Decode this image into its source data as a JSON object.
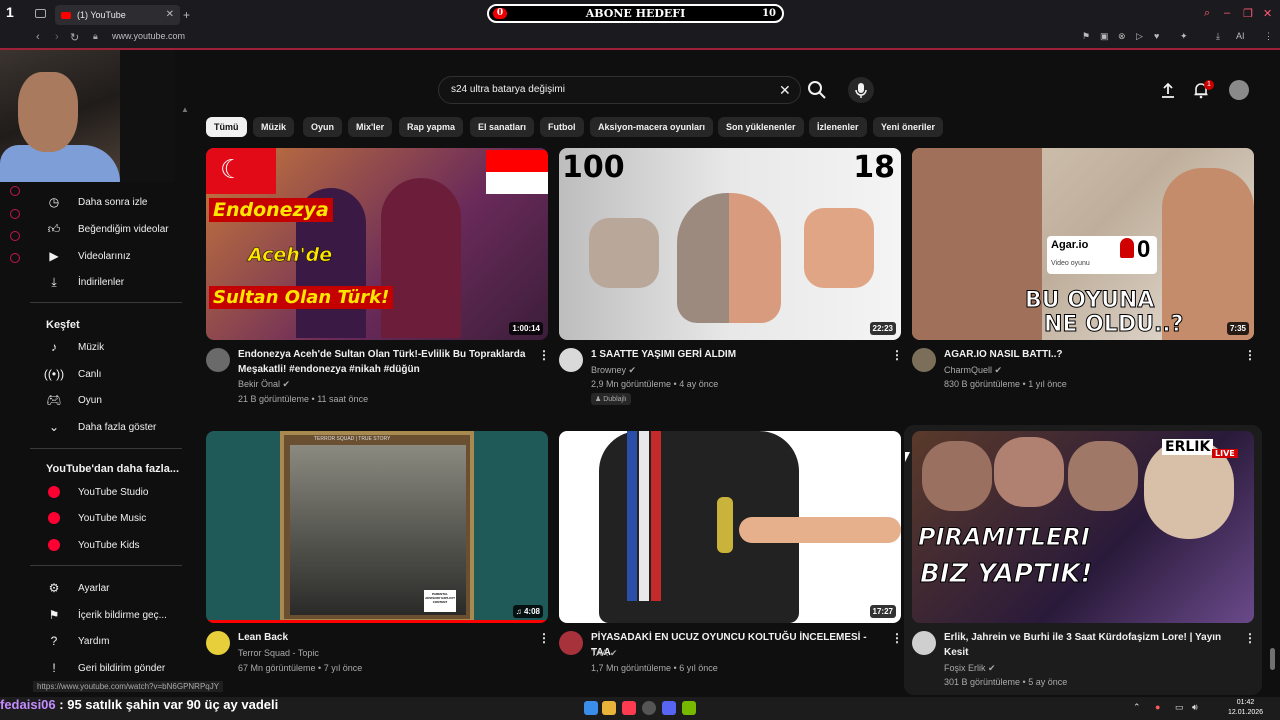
{
  "browser": {
    "tab_title": "(1) YouTube",
    "url": "www.youtube.com",
    "status_url": "https://www.youtube.com/watch?v=bN6GPNRPqJY"
  },
  "overlay": {
    "goal_label": "ABONE HEDEFI",
    "goal_current": "0",
    "goal_target": "10",
    "chat_user": "fedaisi06",
    "chat_message": " : 95 satılık şahin var 90 üç ay vadeli"
  },
  "search": {
    "query": "s24 ultra batarya değişimi"
  },
  "notifications": {
    "count": "1"
  },
  "sidebar": {
    "items_top": [
      {
        "label": "Daha sonra izle",
        "icon": "clock-icon"
      },
      {
        "label": "Beğendiğim videolar",
        "icon": "thumbs-up-icon"
      },
      {
        "label": "Videolarınız",
        "icon": "play-square-icon"
      },
      {
        "label": "İndirilenler",
        "icon": "download-icon"
      }
    ],
    "explore_heading": "Keşfet",
    "explore_items": [
      {
        "label": "Müzik",
        "icon": "music-icon"
      },
      {
        "label": "Canlı",
        "icon": "live-icon"
      },
      {
        "label": "Oyun",
        "icon": "gamepad-icon"
      },
      {
        "label": "Daha fazla göster",
        "icon": "chevron-down-icon"
      }
    ],
    "more_heading": "YouTube'dan daha fazla...",
    "more_items": [
      {
        "label": "YouTube Studio"
      },
      {
        "label": "YouTube Music"
      },
      {
        "label": "YouTube Kids"
      }
    ],
    "bottom_items": [
      {
        "label": "Ayarlar",
        "icon": "gear-icon"
      },
      {
        "label": "İçerik bildirme geç...",
        "icon": "flag-icon"
      },
      {
        "label": "Yardım",
        "icon": "help-icon"
      },
      {
        "label": "Geri bildirim gönder",
        "icon": "feedback-icon"
      }
    ]
  },
  "chips": [
    "Tümü",
    "Müzik",
    "Oyun",
    "Mix'ler",
    "Rap yapma",
    "El sanatları",
    "Futbol",
    "Aksiyon-macera oyunları",
    "Son yüklenenler",
    "İzlenenler",
    "Yeni öneriler"
  ],
  "videos": [
    {
      "title_1": "Endonezya Aceh'de Sultan Olan Türk!-Evlilik Bu Topraklarda",
      "title_2": "Meşakatli! #endonezya #nikah #düğün",
      "channel": "Bekir Önal",
      "meta": "21 B görüntüleme • 11 saat önce",
      "duration": "1:00:14",
      "thumb_text": [
        "Endonezya",
        "Aceh'de",
        "Sultan Olan Türk!"
      ]
    },
    {
      "title_1": "1 SAATTE YAŞIMI GERİ ALDIM",
      "title_2": "",
      "channel": "Browney",
      "meta": "2,9 Mn görüntüleme • 4 ay önce",
      "duration": "22:23",
      "badge": "Dublajlı",
      "thumb_text": [
        "100",
        "18"
      ]
    },
    {
      "title_1": "AGAR.IO NASIL BATTI..?",
      "title_2": "",
      "channel": "CharmQuell",
      "meta": "830 B görüntüleme • 1 yıl önce",
      "duration": "7:35",
      "thumb_text": [
        "Agar.io",
        "Video oyunu",
        "0",
        "BU OYUNA",
        "NE OLDU..?"
      ]
    },
    {
      "title_1": "Lean Back",
      "title_2": "",
      "channel": "Terror Squad - Topic",
      "meta": "67 Mn görüntüleme • 7 yıl önce",
      "duration": "4:08",
      "thumb_text": [
        "TERROR SQUAD | TRUE STORY",
        "PARENTAL ADVISORY EXPLICIT CONTENT"
      ]
    },
    {
      "title_1": "PİYASADAKİ EN UCUZ OYUNCU KOLTUĞU İNCELEMESİ -TAA",
      "title_2": "",
      "channel": "TAA",
      "meta": "1,7 Mn görüntüleme • 6 yıl önce",
      "duration": "17:27"
    },
    {
      "title_1": "Erlik, Jahrein ve Burhi ile 3 Saat Kürdofaşizm Lore! | Yayın",
      "title_2": "Kesit",
      "channel": "Foşix Erlik",
      "meta": "301 B görüntüleme • 5 ay önce",
      "thumb_text": [
        "ERLIK",
        "LIVE",
        "PIRAMITLERI",
        "BIZ YAPTIK!"
      ]
    }
  ],
  "clock": {
    "time": "01:42",
    "date": "12.01.2026"
  },
  "colors": {
    "youtube_red": "#ff0000",
    "background": "#0f0f0f",
    "chip_bg": "#272727"
  }
}
